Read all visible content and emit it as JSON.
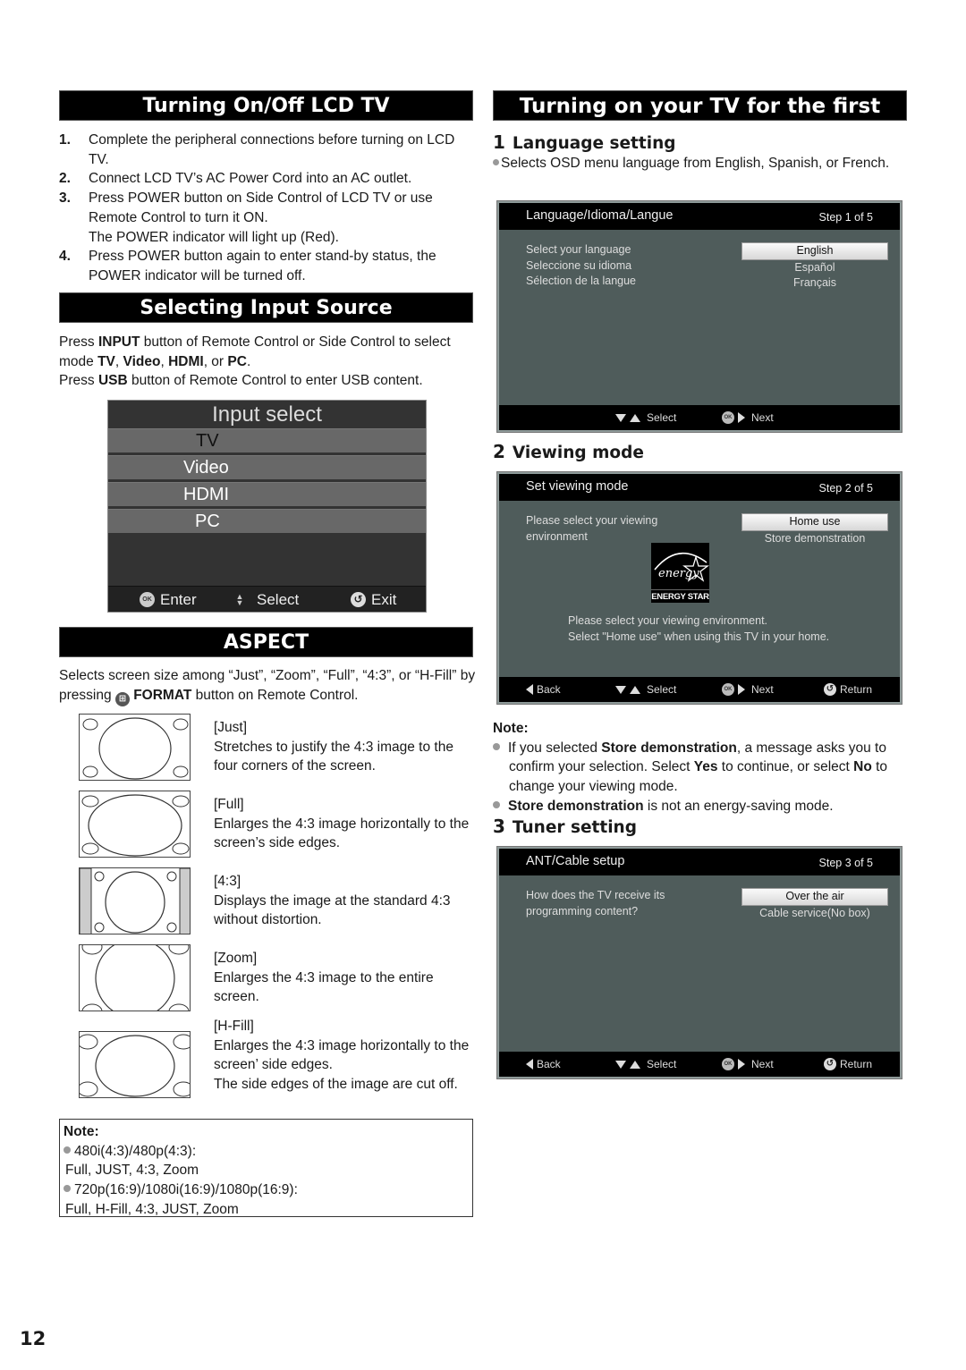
{
  "page_number": "12",
  "left": {
    "turning_on_off": {
      "title": "Turning On/Off LCD TV",
      "steps": [
        {
          "num": "1.",
          "text": "Complete the peripheral connections before turning on LCD TV."
        },
        {
          "num": "2.",
          "text": "Connect LCD TV’s AC Power Cord into an AC outlet."
        },
        {
          "num": "3.",
          "text": "Press POWER button on Side Control of LCD TV or use Remote Control to turn it ON.",
          "extra": "The POWER indicator will light up (Red)."
        },
        {
          "num": "4.",
          "text": "Press POWER button again to enter stand-by status, the POWER indicator will be turned off."
        }
      ]
    },
    "input_source": {
      "title": "Selecting Input Source",
      "p1_a": "Press ",
      "p1_b": "INPUT",
      "p1_c": " button of Remote Control or Side Control to select mode ",
      "p1_tv": "TV",
      "p1_video": "Video",
      "p1_hdmi": "HDMI",
      "p1_or": ", or ",
      "p1_pc": "PC",
      "p2_a": "Press ",
      "p2_b": "USB",
      "p2_c": " button of Remote Control to enter USB content.",
      "menu": {
        "title": "Input select",
        "items": [
          "TV",
          "Video",
          "HDMI",
          "PC"
        ],
        "selected": "TV",
        "footer": {
          "enter": "Enter",
          "select": "Select",
          "exit": "Exit",
          "ok_glyph": "OK"
        }
      }
    },
    "aspect": {
      "title": "ASPECT",
      "intro_a": "Selects screen size among “Just”, “Zoom”, “Full”, “4:3”, or “H-Fill” by pressing ",
      "intro_b": "FORMAT",
      "intro_c": " button on Remote Control.",
      "modes": [
        {
          "name": "[Just]",
          "desc": "Stretches to justify the 4:3 image to the four corners of the screen."
        },
        {
          "name": "[Full]",
          "desc": "Enlarges the 4:3 image horizontally to the screen’s side edges."
        },
        {
          "name": "[4:3]",
          "desc": "Displays the image at the standard 4:3 without distortion."
        },
        {
          "name": "[Zoom]",
          "desc": "Enlarges the 4:3 image to the entire screen."
        },
        {
          "name": "[H-Fill]",
          "desc": "Enlarges the 4:3 image horizontally to the screen’ side edges.",
          "extra": "The side edges of the image are cut off."
        }
      ],
      "note": {
        "label": "Note:",
        "items": [
          {
            "head": "480i(4:3)/480p(4:3):",
            "value": "Full, JUST, 4:3, Zoom"
          },
          {
            "head": "720p(16:9)/1080i(16:9)/1080p(16:9):",
            "value": "Full, H-Fill, 4:3, JUST, Zoom"
          }
        ]
      }
    }
  },
  "right": {
    "title": "Turning on your TV for the first time",
    "step1": {
      "num": "1",
      "title": "Language setting",
      "desc": "Selects OSD menu language from English, Spanish, or French.",
      "screen": {
        "header": "Language/Idioma/Langue",
        "step": "Step 1 of 5",
        "labels": [
          "Select your language",
          "Seleccione su idioma",
          "Sélection de la langue"
        ],
        "options": [
          "English",
          "Español",
          "Français"
        ],
        "selected": "English",
        "footer": {
          "select": "Select",
          "next": "Next"
        }
      }
    },
    "step2": {
      "num": "2",
      "title": "Viewing mode",
      "screen": {
        "header": "Set viewing mode",
        "step": "Step 2 of 5",
        "label": "Please select your viewing environment",
        "options": [
          "Home use",
          "Store demonstration"
        ],
        "selected": "Home use",
        "energy_star_label": "ENERGY STAR",
        "message_1": "Please select your viewing environment.",
        "message_2": "Select \"Home use\" when using this TV in your home.",
        "footer": {
          "back": "Back",
          "select": "Select",
          "next": "Next",
          "return": "Return"
        }
      },
      "note": {
        "label": "Note:",
        "n1_a": "If you selected ",
        "n1_b": "Store demonstration",
        "n1_c": ", a message asks you to confirm your selection. Select ",
        "n1_yes": "Yes",
        "n1_d": " to continue, or select ",
        "n1_no": "No",
        "n1_e": " to change your viewing mode.",
        "n2_a": "Store demonstration",
        "n2_b": " is not an energy-saving mode."
      }
    },
    "step3": {
      "num": "3",
      "title": "Tuner setting",
      "screen": {
        "header": "ANT/Cable setup",
        "step": "Step 3 of 5",
        "label": "How does the TV receive its programming content?",
        "options": [
          "Over the air",
          "Cable service(No box)"
        ],
        "selected": "Over the air",
        "footer": {
          "back": "Back",
          "select": "Select",
          "next": "Next",
          "return": "Return"
        }
      }
    }
  }
}
